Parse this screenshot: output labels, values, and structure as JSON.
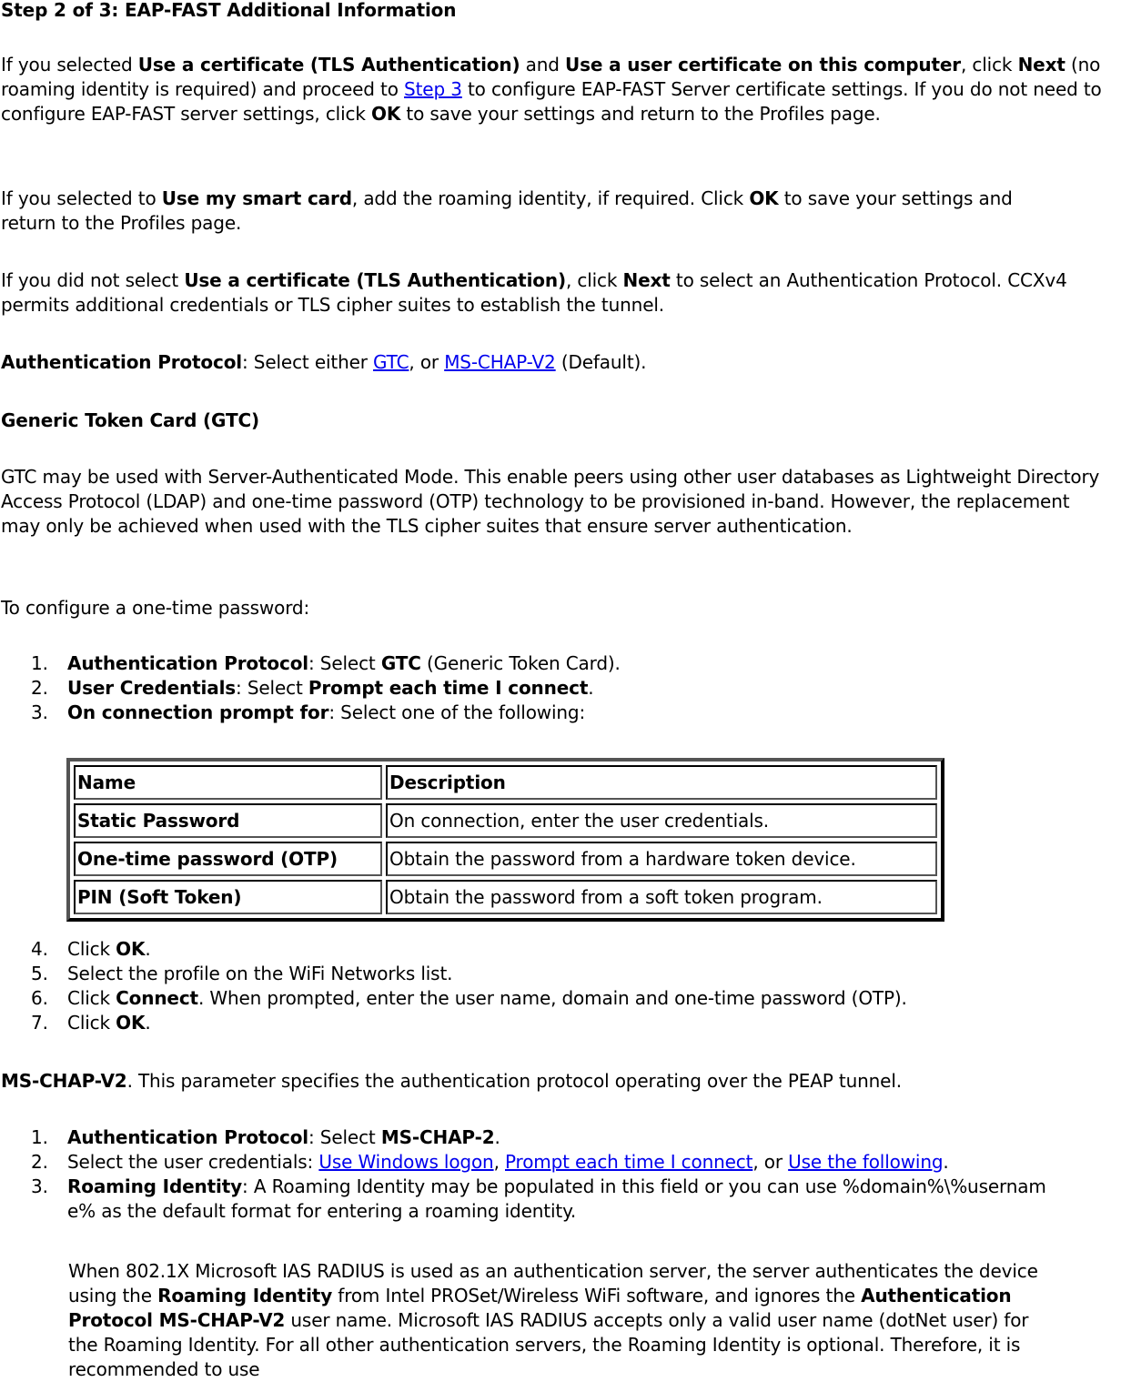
{
  "heading": "Step 2 of 3: EAP-FAST Additional Information",
  "para1": {
    "t1": "If you selected ",
    "b1": "Use a certificate (TLS Authentication)",
    "t2": " and ",
    "b2": "Use a user certificate on this computer",
    "t3": ", click ",
    "b3": "Next",
    "t4": " (no roaming identity is required) and proceed to ",
    "link": "Step 3",
    "t5": " to configure EAP-FAST Server certificate settings. If you do not need to configure EAP-FAST server settings, click ",
    "b4": "OK",
    "t6": " to save your settings and return to the Profiles page."
  },
  "para2": {
    "t1": "If you selected to ",
    "b1": "Use my smart card",
    "t2": ", add the roaming identity, if required. Click ",
    "b2": "OK",
    "t3": " to save your settings and return to the Profiles page."
  },
  "para3": {
    "t1": "If you did not select ",
    "b1": "Use a certificate (TLS Authentication)",
    "t2": ", click ",
    "b2": "Next",
    "t3": " to select an Authentication Protocol. CCXv4 permits additional credentials or TLS cipher suites to establish the tunnel."
  },
  "para4": {
    "b1": "Authentication Protocol",
    "t1": ": Select either ",
    "link1": "GTC",
    "t2": ", or ",
    "link2": "MS-CHAP-V2",
    "t3": " (Default)."
  },
  "gtc_heading": "Generic Token Card (GTC)",
  "gtc_para": "GTC may be used with Server-Authenticated Mode. This enable peers using other user databases as Lightweight Directory Access Protocol (LDAP) and one-time password (OTP) technology to be provisioned in-band. However, the replacement may only be achieved when used with the TLS cipher suites that ensure server authentication.",
  "otp_intro": "To configure a one-time password:",
  "gtc_steps_a": [
    {
      "num": "1.",
      "b1": "Authentication Protocol",
      "t1": ": Select ",
      "b2": "GTC",
      "t2": " (Generic Token Card)."
    },
    {
      "num": "2.",
      "b1": "User Credentials",
      "t1": ": Select ",
      "b2": "Prompt each time I connect",
      "t2": "."
    },
    {
      "num": "3.",
      "b1": "On connection prompt for",
      "t1": ": Select one of the following:"
    }
  ],
  "table": {
    "headers": [
      "Name",
      "Description"
    ],
    "rows": [
      [
        "Static Password",
        "On connection, enter the user credentials."
      ],
      [
        "One-time password (OTP)",
        "Obtain the password from a hardware token device."
      ],
      [
        "PIN (Soft Token)",
        "Obtain the password from a soft token program."
      ]
    ]
  },
  "gtc_steps_b": [
    {
      "num": "4.",
      "t1": "Click ",
      "b1": "OK",
      "t2": "."
    },
    {
      "num": "5.",
      "t1": "Select the profile on the WiFi Networks list."
    },
    {
      "num": "6.",
      "t1": "Click ",
      "b1": "Connect",
      "t2": ". When prompted, enter the user name, domain and one-time password (OTP)."
    },
    {
      "num": "7.",
      "t1": "Click ",
      "b1": "OK",
      "t2": "."
    }
  ],
  "mschap_para": {
    "b1": "MS-CHAP-V2",
    "t1": ". This parameter specifies the authentication protocol operating over the PEAP tunnel."
  },
  "mschap_steps": [
    {
      "num": "1.",
      "b1": "Authentication Protocol",
      "t1": ": Select ",
      "b2": "MS-CHAP-2",
      "t2": "."
    },
    {
      "num": "2.",
      "t1": "Select the user credentials: ",
      "link1": "Use Windows logon",
      "t2": ", ",
      "link2": "Prompt each time I connect",
      "t3": ", or ",
      "link3": "Use the following",
      "t4": "."
    },
    {
      "num": "3.",
      "b1": "Roaming Identity",
      "t1": ": A Roaming Identity may be populated in this field or you can use %domain%\\%username% as the default format for entering a roaming identity."
    }
  ],
  "ias_para": {
    "t1": "When 802.1X Microsoft IAS RADIUS is used as an authentication server, the server authenticates the device using the ",
    "b1": "Roaming Identity",
    "t2": " from Intel PROSet/Wireless WiFi software, and ignores the ",
    "b2": "Authentication Protocol MS-CHAP-V2",
    "t3": " user name. Microsoft IAS RADIUS accepts only a valid user name (dotNet user) for the Roaming Identity. For all other authentication servers, the Roaming Identity is optional. Therefore, it is recommended to use"
  }
}
